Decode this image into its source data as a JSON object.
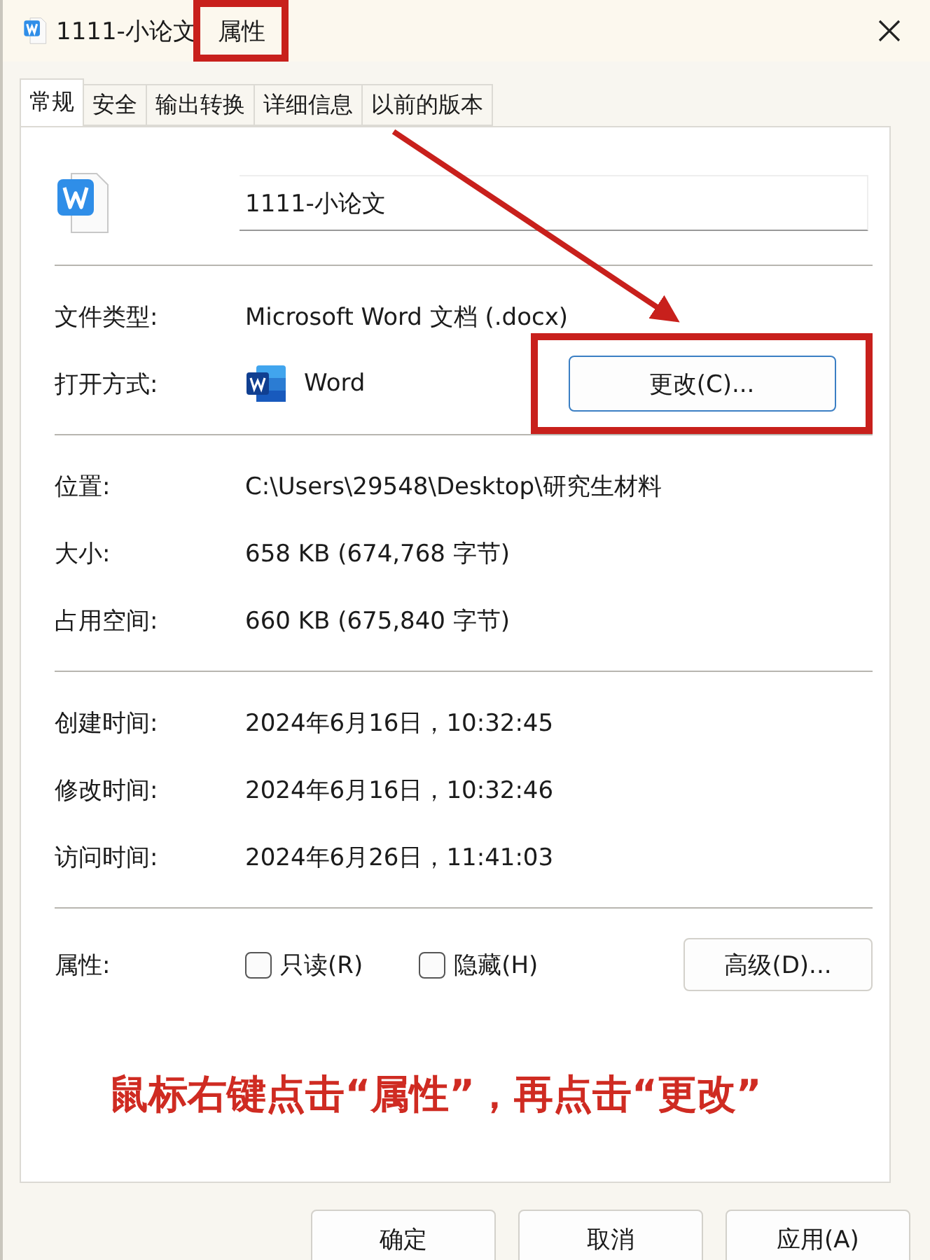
{
  "window": {
    "title": "1111-小论文",
    "title_tail": "属性"
  },
  "tabs": [
    {
      "label": "常规",
      "selected": true
    },
    {
      "label": "安全",
      "selected": false
    },
    {
      "label": "输出转换",
      "selected": false
    },
    {
      "label": "详细信息",
      "selected": false
    },
    {
      "label": "以前的版本",
      "selected": false
    }
  ],
  "file_name": "1111-小论文",
  "file_type": {
    "label": "文件类型:",
    "value": "Microsoft Word 文档 (.docx)"
  },
  "open_with": {
    "label": "打开方式:",
    "app": "Word",
    "button": "更改(C)..."
  },
  "groups": [
    [
      {
        "label": "位置:",
        "value": "C:\\Users\\29548\\Desktop\\研究生材料"
      },
      {
        "label": "大小:",
        "value": "658 KB (674,768 字节)"
      },
      {
        "label": "占用空间:",
        "value": "660 KB (675,840 字节)"
      }
    ],
    [
      {
        "label": "创建时间:",
        "value": "2024年6月16日，10:32:45"
      },
      {
        "label": "修改时间:",
        "value": "2024年6月16日，10:32:46"
      },
      {
        "label": "访问时间:",
        "value": "2024年6月26日，11:41:03"
      }
    ]
  ],
  "attributes": {
    "label": "属性:",
    "checkboxes": [
      {
        "label": "只读(R)",
        "checked": false
      },
      {
        "label": "隐藏(H)",
        "checked": false
      }
    ],
    "button": "高级(D)..."
  },
  "annotation": {
    "highlight_title": true,
    "highlight_change": true,
    "arrow": true,
    "caption": "鼠标右键点击“属性”，再点击“更改”"
  },
  "buttons": [
    "确定",
    "取消",
    "应用(A)"
  ]
}
